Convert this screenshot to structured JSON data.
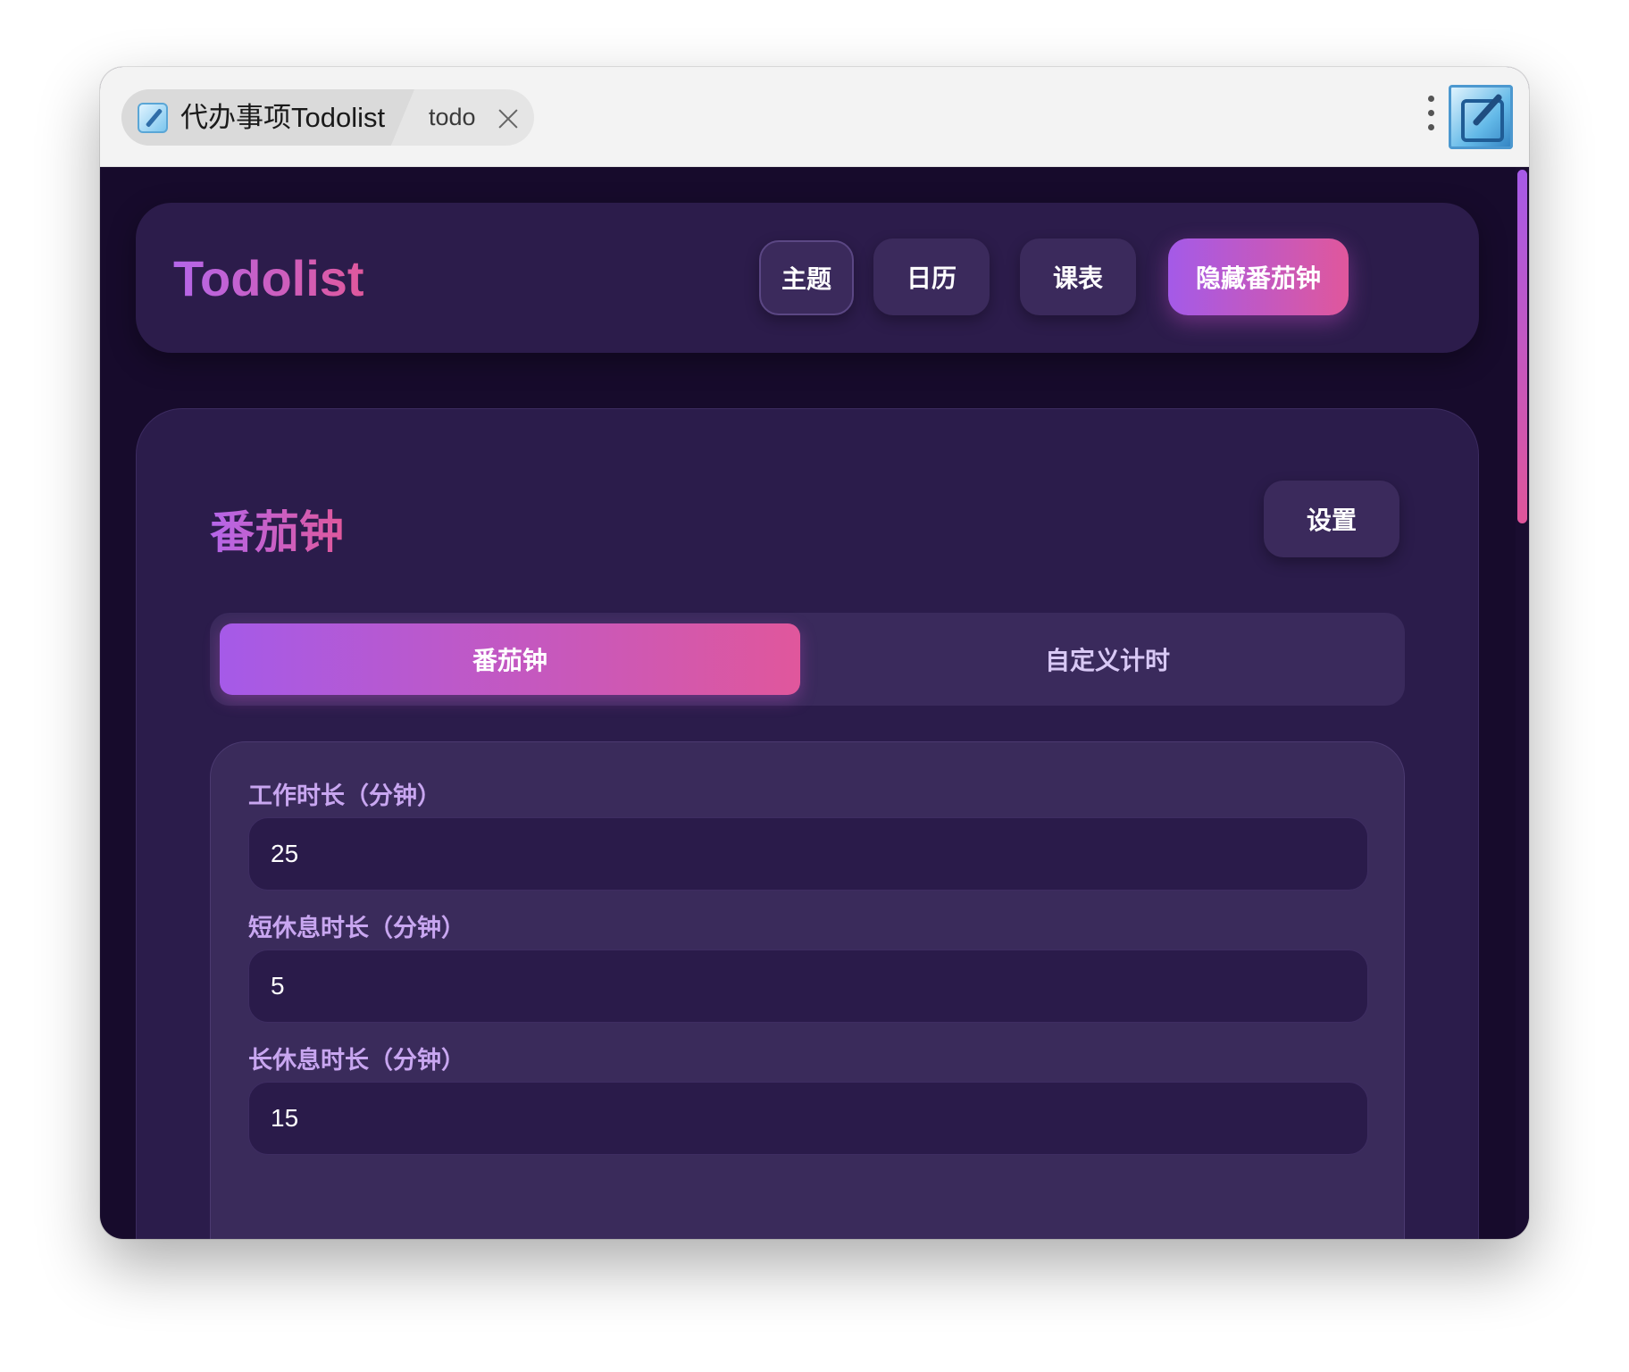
{
  "window": {
    "tab_title": "代办事项Todolist",
    "tab_subtitle": "todo"
  },
  "header": {
    "brand": "Todolist",
    "buttons": {
      "theme": "主题",
      "calendar": "日历",
      "schedule": "课表",
      "hide_pomodoro": "隐藏番茄钟"
    }
  },
  "pomodoro": {
    "title": "番茄钟",
    "settings_label": "设置",
    "modes": {
      "pomodoro": "番茄钟",
      "custom": "自定义计时"
    },
    "active_mode": "pomodoro",
    "fields": {
      "work": {
        "label": "工作时长（分钟）",
        "value": "25"
      },
      "short_break": {
        "label": "短休息时长（分钟）",
        "value": "5"
      },
      "long_break": {
        "label": "长休息时长（分钟）",
        "value": "15"
      }
    }
  },
  "colors": {
    "accent_start": "#a45ae8",
    "accent_end": "#e0579c",
    "background": "#170b2c",
    "card": "#2c1c4b"
  }
}
